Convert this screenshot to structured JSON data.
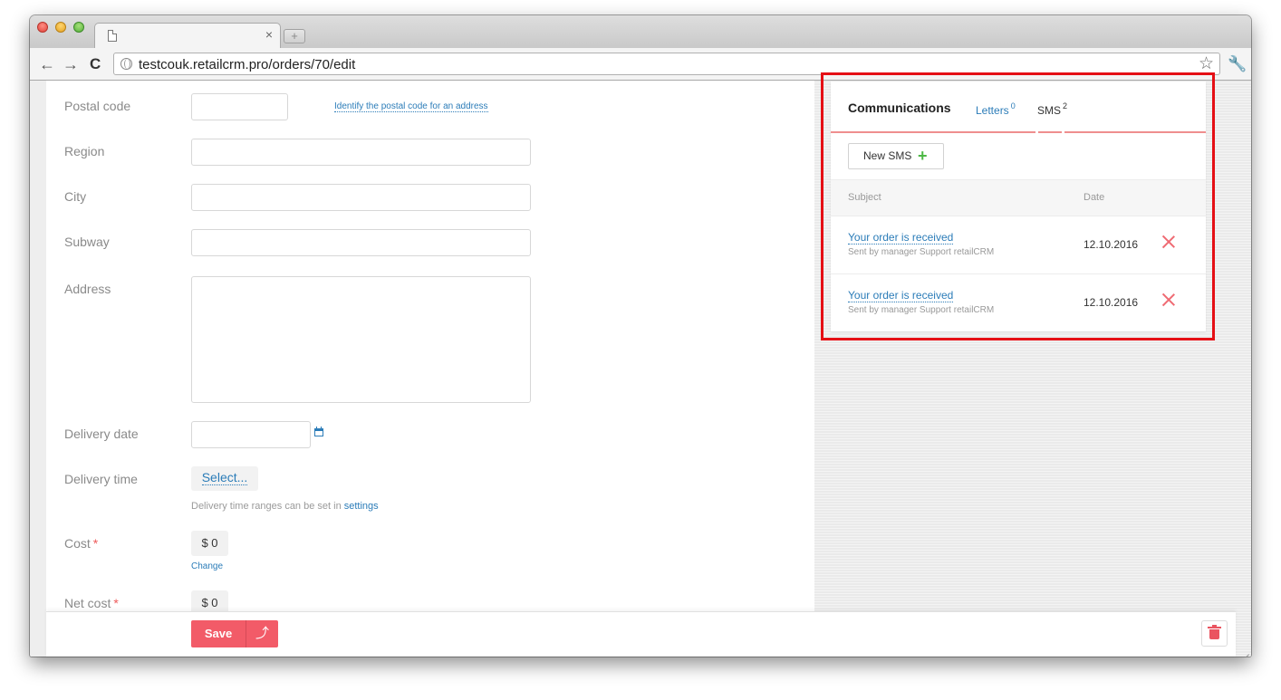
{
  "browser": {
    "url": "testcouk.retailcrm.pro/orders/70/edit",
    "tab_close": "×",
    "newtab": "+",
    "back": "←",
    "forward": "→",
    "reload": "C",
    "star": "☆",
    "wrench": "🔧"
  },
  "form": {
    "postal_code": {
      "label": "Postal code",
      "value": "",
      "link": "Identify the postal code for an address"
    },
    "region": {
      "label": "Region",
      "value": ""
    },
    "city": {
      "label": "City",
      "value": ""
    },
    "subway": {
      "label": "Subway",
      "value": ""
    },
    "address": {
      "label": "Address",
      "value": ""
    },
    "delivery_date": {
      "label": "Delivery date",
      "value": ""
    },
    "delivery_time": {
      "label": "Delivery time",
      "select_label": "Select...",
      "hint": "Delivery time ranges can be set in ",
      "hint_link": "settings"
    },
    "cost": {
      "label": "Cost",
      "required_mark": "*",
      "value": "$ 0",
      "change_link": "Change"
    },
    "net_cost": {
      "label": "Net cost",
      "required_mark": "*",
      "value": "$ 0"
    }
  },
  "actions": {
    "save_label": "Save",
    "save_arrow": "⤴"
  },
  "communications": {
    "title": "Communications",
    "letters_label": "Letters",
    "letters_count": "0",
    "sms_label": "SMS",
    "sms_count": "2",
    "new_sms_label": "New SMS",
    "plus": "+",
    "columns": {
      "subject": "Subject",
      "date": "Date"
    },
    "messages": [
      {
        "subject": "Your order is received",
        "sender": "Sent by manager Support retailCRM",
        "date": "12.10.2016"
      },
      {
        "subject": "Your order is received",
        "sender": "Sent by manager Support retailCRM",
        "date": "12.10.2016"
      }
    ]
  },
  "colors": {
    "accent_link": "#2b7cb8",
    "save_button": "#f25b68",
    "highlight_border": "#e50f15",
    "plus_green": "#4db845"
  }
}
